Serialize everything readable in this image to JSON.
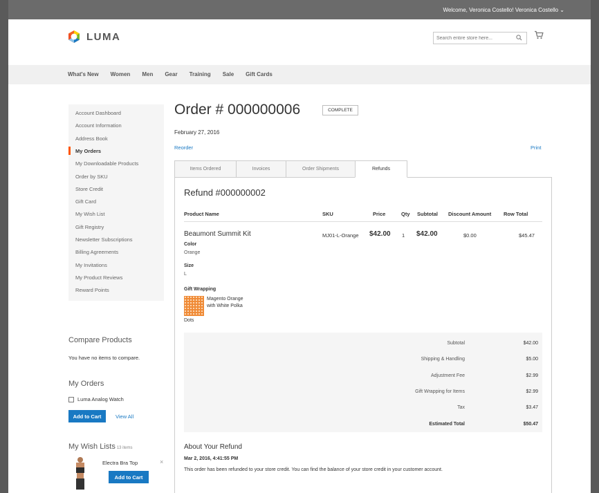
{
  "header": {
    "welcome": "Welcome, Veronica Costello!  Veronica Costello ⌄",
    "logo_text": "LUMA",
    "search_placeholder": "Search entire store here..."
  },
  "nav": {
    "items": [
      "What's New",
      "Women",
      "Men",
      "Gear",
      "Training",
      "Sale",
      "Gift Cards"
    ]
  },
  "sidebar": {
    "items": [
      {
        "label": "Account Dashboard",
        "active": false
      },
      {
        "label": "Account Information",
        "active": false
      },
      {
        "label": "Address Book",
        "active": false
      },
      {
        "label": "My Orders",
        "active": true
      },
      {
        "label": "My Downloadable Products",
        "active": false
      },
      {
        "label": "Order by SKU",
        "active": false
      },
      {
        "label": "Store Credit",
        "active": false
      },
      {
        "label": "Gift Card",
        "active": false
      },
      {
        "label": "My Wish List",
        "active": false
      },
      {
        "label": "Gift Registry",
        "active": false
      },
      {
        "label": "Newsletter Subscriptions",
        "active": false
      },
      {
        "label": "Billing Agreements",
        "active": false
      },
      {
        "label": "My Invitations",
        "active": false
      },
      {
        "label": "My Product Reviews",
        "active": false
      },
      {
        "label": "Reward Points",
        "active": false
      }
    ],
    "accent_color": "#ff5501"
  },
  "compare": {
    "title": "Compare Products",
    "empty_text": "You have no items to compare."
  },
  "my_orders_block": {
    "title": "My Orders",
    "item": "Luma Analog Watch",
    "add_to_cart": "Add to Cart",
    "view_all": "View All"
  },
  "wishlist_block": {
    "title": "My Wish Lists",
    "count": "13 items",
    "item_name": "Electra Bra Top",
    "add_to_cart": "Add to Cart",
    "close": "×"
  },
  "order": {
    "title": "Order # 000000006",
    "status": "COMPLETE",
    "date": "February 27, 2016",
    "reorder": "Reorder",
    "print": "Print"
  },
  "tabs": [
    {
      "label": "Items Ordered",
      "active": false
    },
    {
      "label": "Invoices",
      "active": false
    },
    {
      "label": "Order Shipments",
      "active": false
    },
    {
      "label": "Refunds",
      "active": true
    }
  ],
  "refund": {
    "title": "Refund #000000002",
    "columns": [
      "Product Name",
      "SKU",
      "Price",
      "Qty",
      "Subtotal",
      "Discount Amount",
      "Row Total"
    ],
    "item": {
      "name": "Beaumont Summit Kit",
      "sku": "MJ01-L-Orange",
      "price": "$42.00",
      "qty": "1",
      "subtotal": "$42.00",
      "discount": "$0.00",
      "row_total": "$45.47",
      "options": [
        {
          "label": "Color",
          "value": "Orange"
        },
        {
          "label": "Size",
          "value": "L"
        }
      ],
      "gift_wrapping_label": "Gift Wrapping",
      "gift_wrapping_name": "Magento Orange with White Polka",
      "gift_wrapping_tail": "Dots"
    },
    "totals": [
      {
        "label": "Subtotal",
        "value": "$42.00",
        "strong": false
      },
      {
        "label": "Shipping & Handling",
        "value": "$5.00",
        "strong": false
      },
      {
        "label": "Adjustment Fee",
        "value": "$2.99",
        "strong": false
      },
      {
        "label": "Gift Wrapping for Items",
        "value": "$2.99",
        "strong": false
      },
      {
        "label": "Tax",
        "value": "$3.47",
        "strong": false
      },
      {
        "label": "Estimated Total",
        "value": "$50.47",
        "strong": true
      }
    ]
  },
  "about": {
    "title": "About Your Refund",
    "date": "Mar 2, 2016, 4:41:55 PM",
    "text": "This order has been refunded to your store credit. You can find the balance of your store credit in your customer account."
  },
  "colors": {
    "topbar": "#6b6b6b",
    "link": "#1979c3",
    "button": "#1979c3",
    "nav_bg": "#f0f0f0"
  }
}
